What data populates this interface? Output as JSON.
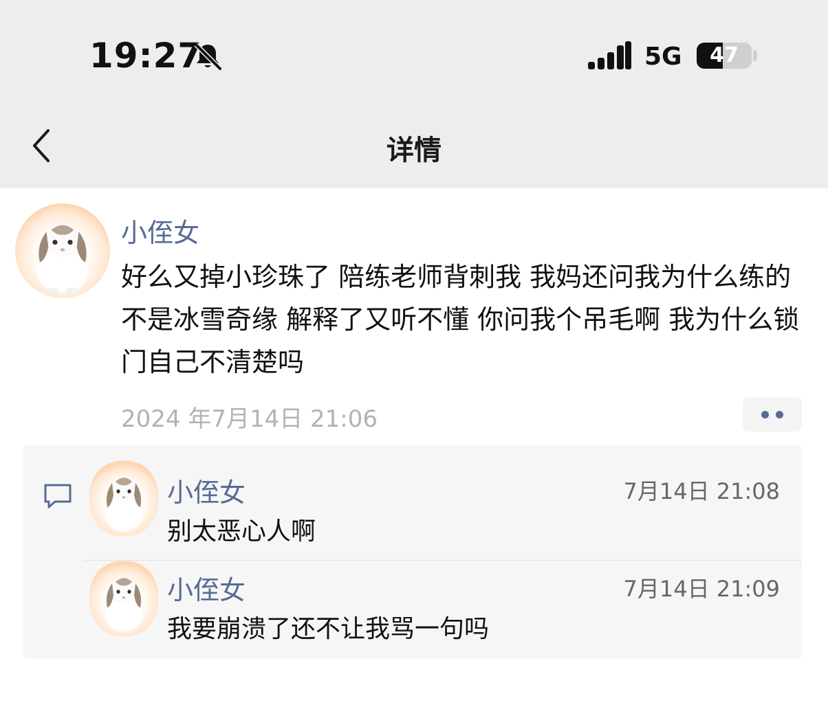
{
  "status_bar": {
    "time": "19:27",
    "network": "5G",
    "battery": "47",
    "battery_level": 0.47
  },
  "nav": {
    "title": "详情"
  },
  "post": {
    "author": "小侄女",
    "text": "好么又掉小珍珠了 陪练老师背刺我 我妈还问我为什么练的不是冰雪奇缘 解释了又听不懂 你问我个吊毛啊 我为什么锁门自己不清楚吗",
    "time": "2024 年7月14日 21:06"
  },
  "comments": [
    {
      "author": "小侄女",
      "time": "7月14日 21:08",
      "text": "别太恶心人啊"
    },
    {
      "author": "小侄女",
      "time": "7月14日 21:09",
      "text": "我要崩溃了还不让我骂一句吗"
    }
  ],
  "icons": {
    "bell": "bell-muted-icon",
    "signal": "signal-icon",
    "back": "chevron-left-icon",
    "more": "more-dots-icon",
    "comment": "comment-icon",
    "avatar": "rabbit-avatar"
  },
  "colors": {
    "link_name": "#576b95",
    "header_bg": "#ededed",
    "timestamp": "#b2b2b2"
  }
}
